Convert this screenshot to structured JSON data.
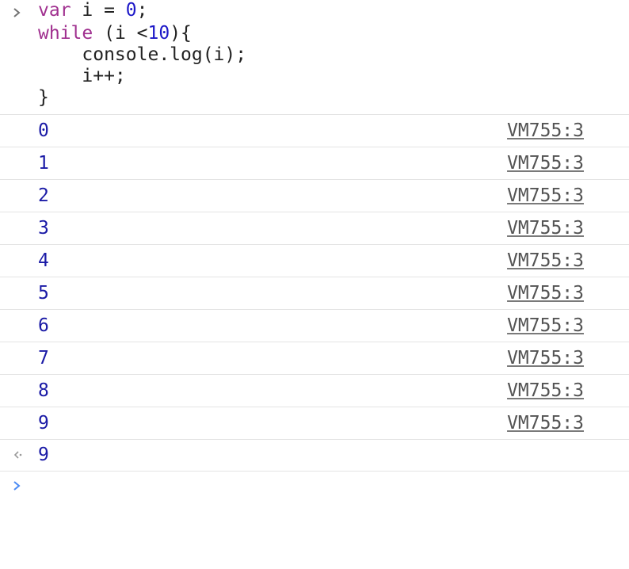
{
  "input_block": {
    "lines": [
      [
        {
          "t": "var",
          "c": "kw"
        },
        {
          "t": " i = ",
          "c": "plain"
        },
        {
          "t": "0",
          "c": "num"
        },
        {
          "t": ";",
          "c": "plain"
        }
      ],
      [
        {
          "t": "while",
          "c": "kw"
        },
        {
          "t": " (i <",
          "c": "plain"
        },
        {
          "t": "10",
          "c": "num"
        },
        {
          "t": "){",
          "c": "plain"
        }
      ],
      [
        {
          "t": "    console.log(i);",
          "c": "plain"
        }
      ],
      [
        {
          "t": "    i++;",
          "c": "plain"
        }
      ],
      [
        {
          "t": "}",
          "c": "plain"
        }
      ]
    ]
  },
  "logs": [
    {
      "value": "0",
      "source": "VM755:3"
    },
    {
      "value": "1",
      "source": "VM755:3"
    },
    {
      "value": "2",
      "source": "VM755:3"
    },
    {
      "value": "3",
      "source": "VM755:3"
    },
    {
      "value": "4",
      "source": "VM755:3"
    },
    {
      "value": "5",
      "source": "VM755:3"
    },
    {
      "value": "6",
      "source": "VM755:3"
    },
    {
      "value": "7",
      "source": "VM755:3"
    },
    {
      "value": "8",
      "source": "VM755:3"
    },
    {
      "value": "9",
      "source": "VM755:3"
    }
  ],
  "result": {
    "value": "9"
  },
  "prompt": {
    "value": ""
  },
  "colors": {
    "keyword": "#a0308f",
    "number": "#1d18c8",
    "log_value": "#1a1aa6",
    "source_link": "#545454",
    "prompt_chevron": "#4a8af4",
    "input_chevron": "#727272"
  },
  "icons": {
    "input_marker": "chevron-right-icon",
    "result_marker": "result-arrow-icon",
    "prompt_marker": "prompt-chevron-icon"
  }
}
